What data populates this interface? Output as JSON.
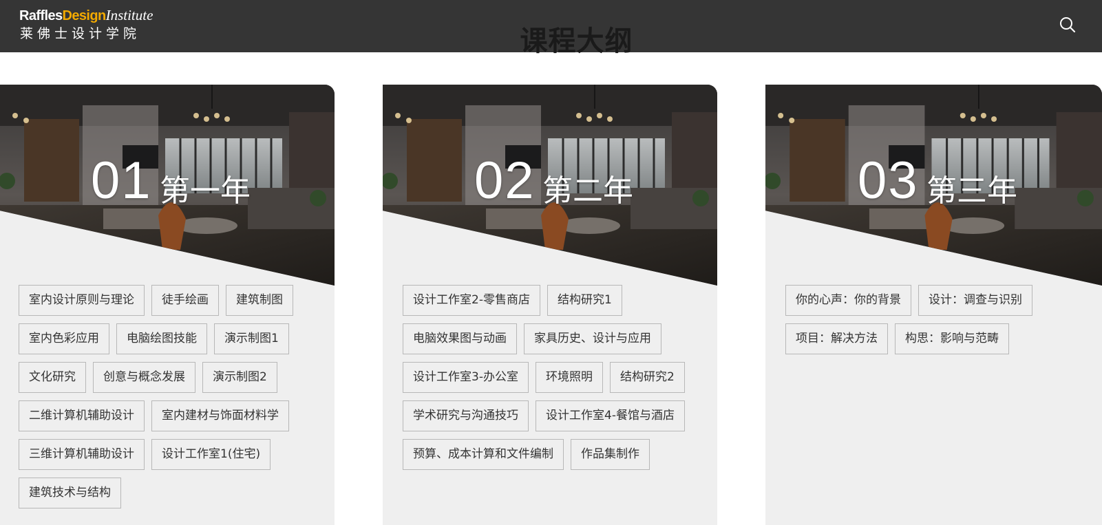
{
  "header": {
    "logo_en_prefix": "Raffles",
    "logo_en_design": "Design",
    "logo_en_suffix": "Institute",
    "logo_cn": "莱佛士设计学院",
    "search_icon": "search-icon"
  },
  "page": {
    "title": "课程大纲"
  },
  "colors": {
    "topbar": "#353535",
    "accent": "#f2a900",
    "card_bg": "#efefef",
    "tag_border": "#b7b7b7"
  },
  "years": [
    {
      "number": "01",
      "label": "第一年",
      "courses": [
        "室内设计原则与理论",
        "徒手绘画",
        "建筑制图",
        "室内色彩应用",
        "电脑绘图技能",
        "演示制图1",
        "文化研究",
        "创意与概念发展",
        "演示制图2",
        "二维计算机辅助设计",
        "室内建材与饰面材料学",
        "三维计算机辅助设计",
        "设计工作室1(住宅)",
        "建筑技术与结构"
      ]
    },
    {
      "number": "02",
      "label": "第二年",
      "courses": [
        "设计工作室2-零售商店",
        "结构研究1",
        "电脑效果图与动画",
        "家具历史、设计与应用",
        "设计工作室3-办公室",
        "环境照明",
        "结构研究2",
        "学术研究与沟通技巧",
        "设计工作室4-餐馆与酒店",
        "预算、成本计算和文件编制",
        "作品集制作"
      ]
    },
    {
      "number": "03",
      "label": "第三年",
      "courses": [
        "你的心声：你的背景",
        "设计：调查与识别",
        "项目：解决方法",
        "构思：影响与范畴"
      ]
    }
  ]
}
